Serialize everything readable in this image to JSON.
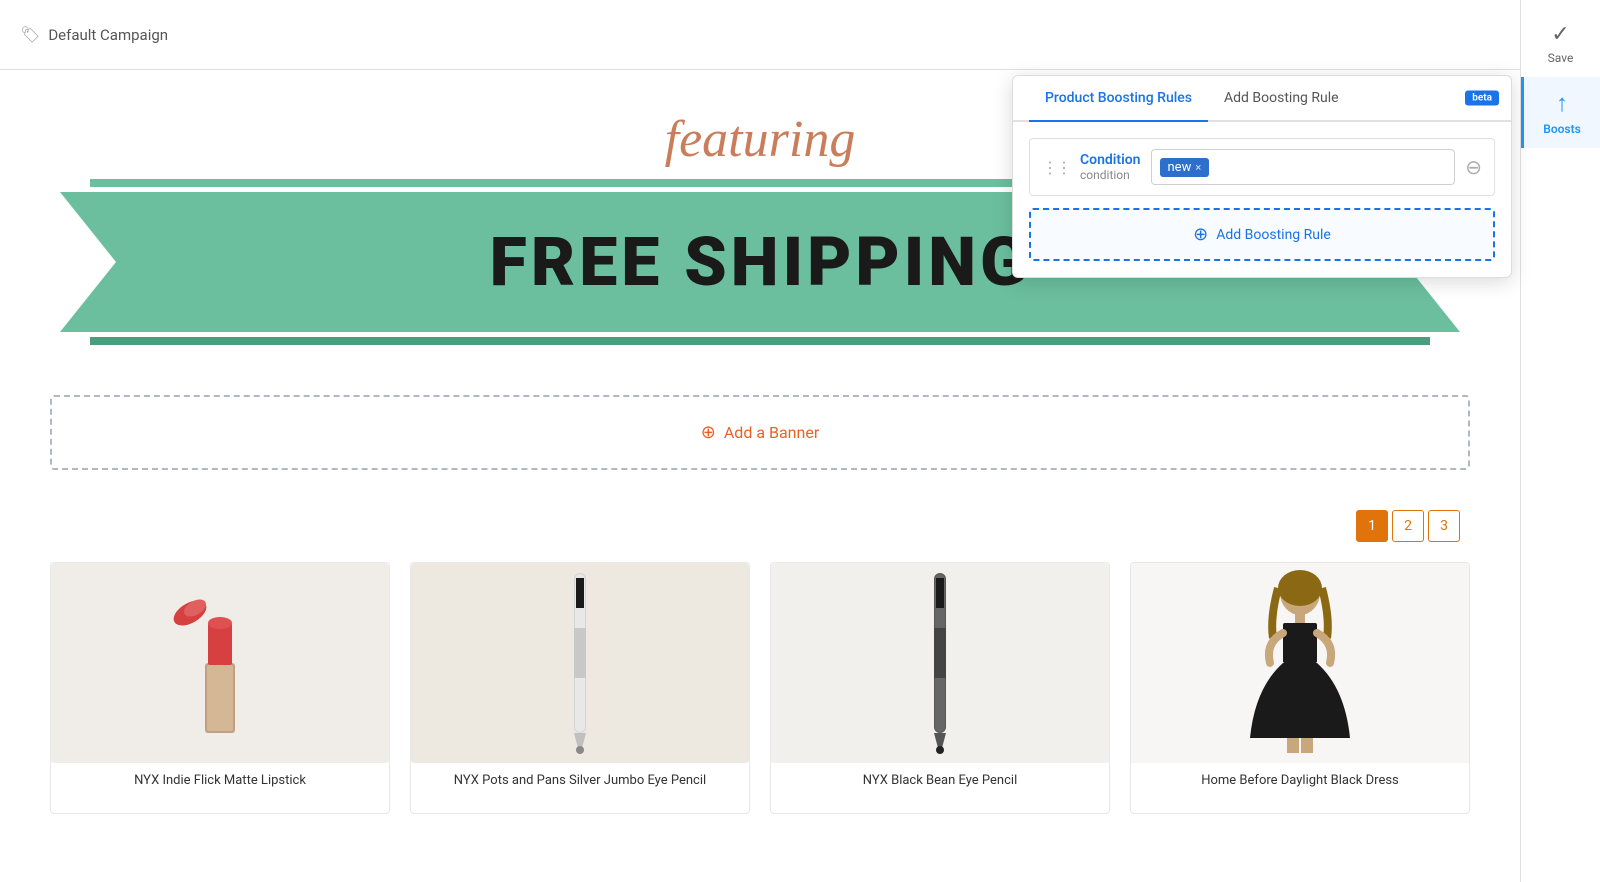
{
  "topbar": {
    "campaign_label": "Default Campaign"
  },
  "sidebar": {
    "save_label": "Save",
    "boosts_label": "Boosts",
    "save_icon": "✓",
    "boosts_icon": "↑"
  },
  "panel": {
    "tab1": "Product Boosting Rules",
    "tab2": "Add Boosting Rule",
    "beta_label": "beta",
    "condition": {
      "title": "Condition",
      "subtitle": "condition",
      "tag_value": "new",
      "tag_close": "×"
    },
    "add_rule_label": "Add Boosting Rule"
  },
  "banner": {
    "featuring_text": "featuring",
    "shipping_text": "FREE SHIPPING"
  },
  "add_banner": {
    "label": "Add a Banner"
  },
  "pagination": {
    "pages": [
      "1",
      "2",
      "3"
    ]
  },
  "products": [
    {
      "name": "NYX Indie Flick Matte Lipstick",
      "type": "lipstick"
    },
    {
      "name": "NYX Pots and Pans Silver Jumbo Eye Pencil",
      "type": "pencil"
    },
    {
      "name": "NYX Black Bean Eye Pencil",
      "type": "pencil2"
    },
    {
      "name": "Home Before Daylight Black Dress",
      "type": "dress"
    }
  ]
}
